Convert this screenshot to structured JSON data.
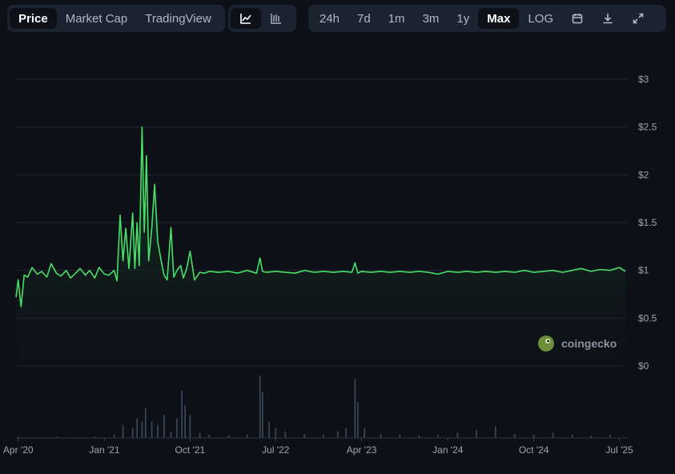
{
  "toolbar": {
    "metric_tabs": [
      {
        "label": "Price",
        "active": true
      },
      {
        "label": "Market Cap",
        "active": false
      },
      {
        "label": "TradingView",
        "active": false
      }
    ],
    "chart_type_icons": [
      {
        "icon": "line-chart-icon",
        "active": true
      },
      {
        "icon": "candlestick-chart-icon",
        "active": false
      }
    ],
    "ranges": [
      {
        "label": "24h",
        "active": false
      },
      {
        "label": "7d",
        "active": false
      },
      {
        "label": "1m",
        "active": false
      },
      {
        "label": "3m",
        "active": false
      },
      {
        "label": "1y",
        "active": false
      },
      {
        "label": "Max",
        "active": true
      },
      {
        "label": "LOG",
        "active": false
      }
    ],
    "action_icons": [
      "calendar-icon",
      "download-icon",
      "expand-icon"
    ]
  },
  "watermark": {
    "text": "coingecko",
    "icon": "coingecko-gecko-icon"
  },
  "colors": {
    "line": "#4ade68",
    "fill_top": "#1d4d2b",
    "background": "#0d1117",
    "grid": "#1f2833",
    "volume": "#3a4a5e"
  },
  "chart_data": {
    "type": "area",
    "title": "",
    "xlabel": "",
    "ylabel": "",
    "y_axis_position": "right",
    "grid": true,
    "ylim": [
      0,
      3
    ],
    "y_ticks": [
      {
        "value": 3,
        "label": "$3"
      },
      {
        "value": 2.5,
        "label": "$2.5"
      },
      {
        "value": 2,
        "label": "$2"
      },
      {
        "value": 1.5,
        "label": "$1.5"
      },
      {
        "value": 1,
        "label": "$1"
      },
      {
        "value": 0.5,
        "label": "$0.5"
      },
      {
        "value": 0,
        "label": "$0"
      }
    ],
    "x_range": [
      "2020-03-25",
      "2025-07-20"
    ],
    "x_ticks": [
      {
        "date": "2020-04-01",
        "label": "Apr '20"
      },
      {
        "date": "2021-01-01",
        "label": "Jan '21"
      },
      {
        "date": "2021-10-01",
        "label": "Oct '21"
      },
      {
        "date": "2022-07-01",
        "label": "Jul '22"
      },
      {
        "date": "2023-04-01",
        "label": "Apr '23"
      },
      {
        "date": "2024-01-01",
        "label": "Jan '24"
      },
      {
        "date": "2024-10-01",
        "label": "Oct '24"
      },
      {
        "date": "2025-07-01",
        "label": "Jul '25"
      }
    ],
    "price_series": {
      "x": [
        "2020-03-25",
        "2020-04-01",
        "2020-04-10",
        "2020-04-20",
        "2020-05-01",
        "2020-05-15",
        "2020-06-01",
        "2020-06-15",
        "2020-07-01",
        "2020-07-15",
        "2020-08-01",
        "2020-08-15",
        "2020-09-01",
        "2020-09-15",
        "2020-10-01",
        "2020-10-15",
        "2020-11-01",
        "2020-11-15",
        "2020-12-01",
        "2020-12-15",
        "2021-01-01",
        "2021-01-15",
        "2021-02-01",
        "2021-02-10",
        "2021-02-20",
        "2021-03-01",
        "2021-03-10",
        "2021-03-20",
        "2021-04-01",
        "2021-04-08",
        "2021-04-15",
        "2021-04-22",
        "2021-05-01",
        "2021-05-08",
        "2021-05-15",
        "2021-05-22",
        "2021-06-01",
        "2021-06-10",
        "2021-06-20",
        "2021-07-01",
        "2021-07-10",
        "2021-07-20",
        "2021-08-01",
        "2021-08-10",
        "2021-08-20",
        "2021-09-01",
        "2021-09-10",
        "2021-09-20",
        "2021-10-01",
        "2021-10-15",
        "2021-11-01",
        "2021-11-15",
        "2021-12-01",
        "2022-01-01",
        "2022-02-01",
        "2022-03-01",
        "2022-04-01",
        "2022-05-01",
        "2022-05-12",
        "2022-05-20",
        "2022-06-01",
        "2022-07-01",
        "2022-08-01",
        "2022-09-01",
        "2022-10-01",
        "2022-11-01",
        "2022-12-01",
        "2023-01-01",
        "2023-02-01",
        "2023-03-01",
        "2023-03-11",
        "2023-03-20",
        "2023-04-01",
        "2023-05-01",
        "2023-06-01",
        "2023-07-01",
        "2023-08-01",
        "2023-09-01",
        "2023-10-01",
        "2023-11-01",
        "2023-12-01",
        "2024-01-01",
        "2024-02-01",
        "2024-03-01",
        "2024-04-01",
        "2024-05-01",
        "2024-06-01",
        "2024-07-01",
        "2024-08-01",
        "2024-09-01",
        "2024-10-01",
        "2024-11-01",
        "2024-12-01",
        "2025-01-01",
        "2025-02-01",
        "2025-03-01",
        "2025-04-01",
        "2025-05-01",
        "2025-06-01",
        "2025-07-01",
        "2025-07-20"
      ],
      "y": [
        0.72,
        0.9,
        0.62,
        0.95,
        0.93,
        1.03,
        0.96,
        0.99,
        0.93,
        1.07,
        0.97,
        0.94,
        1.0,
        0.92,
        0.97,
        1.02,
        0.95,
        1.0,
        0.92,
        1.03,
        0.96,
        0.95,
        1.0,
        0.89,
        1.58,
        1.1,
        1.44,
        1.02,
        1.6,
        1.02,
        1.5,
        1.05,
        2.5,
        1.4,
        2.2,
        1.1,
        1.45,
        1.9,
        1.3,
        1.1,
        0.95,
        0.9,
        1.45,
        0.93,
        1.0,
        1.05,
        0.92,
        1.02,
        1.2,
        0.9,
        0.98,
        0.97,
        0.99,
        0.98,
        0.99,
        0.97,
        1.0,
        0.97,
        1.13,
        0.99,
        0.98,
        0.99,
        0.98,
        0.97,
        1.0,
        0.98,
        0.99,
        0.98,
        0.99,
        0.98,
        1.08,
        0.97,
        0.99,
        0.98,
        0.99,
        0.98,
        0.99,
        0.98,
        0.99,
        0.98,
        0.96,
        0.99,
        0.98,
        0.99,
        0.98,
        0.99,
        0.98,
        0.99,
        0.98,
        1.0,
        0.98,
        0.99,
        1.0,
        0.98,
        1.0,
        1.02,
        0.99,
        1.01,
        1.0,
        1.03,
        0.99
      ]
    },
    "volume_series": {
      "unit": "relative",
      "x": [
        "2020-04-01",
        "2020-06-01",
        "2020-08-01",
        "2020-10-01",
        "2020-12-01",
        "2021-02-01",
        "2021-03-01",
        "2021-04-01",
        "2021-04-15",
        "2021-05-01",
        "2021-05-12",
        "2021-06-01",
        "2021-06-20",
        "2021-07-10",
        "2021-08-01",
        "2021-08-20",
        "2021-09-05",
        "2021-09-15",
        "2021-10-01",
        "2021-11-01",
        "2021-12-01",
        "2022-02-01",
        "2022-04-01",
        "2022-05-12",
        "2022-05-20",
        "2022-06-10",
        "2022-07-01",
        "2022-08-01",
        "2022-10-01",
        "2022-12-01",
        "2023-01-15",
        "2023-02-10",
        "2023-03-11",
        "2023-03-20",
        "2023-04-10",
        "2023-06-01",
        "2023-08-01",
        "2023-10-01",
        "2023-12-01",
        "2024-02-01",
        "2024-04-01",
        "2024-06-01",
        "2024-08-01",
        "2024-10-01",
        "2024-12-01",
        "2025-02-01",
        "2025-04-01",
        "2025-06-01"
      ],
      "values": [
        0.01,
        0.01,
        0.02,
        0.01,
        0.02,
        0.05,
        0.2,
        0.15,
        0.3,
        0.25,
        0.45,
        0.25,
        0.2,
        0.35,
        0.1,
        0.3,
        0.72,
        0.5,
        0.35,
        0.08,
        0.05,
        0.04,
        0.05,
        0.95,
        0.7,
        0.25,
        0.15,
        0.1,
        0.06,
        0.05,
        0.1,
        0.15,
        0.9,
        0.55,
        0.15,
        0.06,
        0.05,
        0.04,
        0.05,
        0.08,
        0.12,
        0.18,
        0.06,
        0.05,
        0.08,
        0.05,
        0.04,
        0.05
      ]
    }
  }
}
